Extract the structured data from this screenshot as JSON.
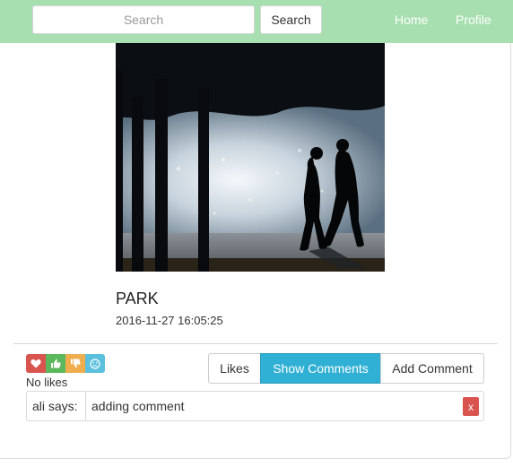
{
  "navbar": {
    "search_placeholder": "Search",
    "search_button": "Search",
    "links": [
      "Home",
      "Profile"
    ],
    "background": "#a8dfb0"
  },
  "post": {
    "title": "PARK",
    "date": "2016-11-27 16:05:25"
  },
  "reactions": {
    "icons": [
      "heart-icon",
      "thumbs-up-icon",
      "thumbs-down-icon",
      "sad-face-icon"
    ],
    "colors": [
      "#d9534f",
      "#5cb85c",
      "#f0ad4e",
      "#5bc0de"
    ],
    "likes_text": "No likes"
  },
  "actions": {
    "likes": "Likes",
    "show_comments": "Show Comments",
    "add_comment": "Add Comment"
  },
  "comments": [
    {
      "author": "ali says:",
      "text": "adding comment",
      "delete_label": "x"
    }
  ]
}
